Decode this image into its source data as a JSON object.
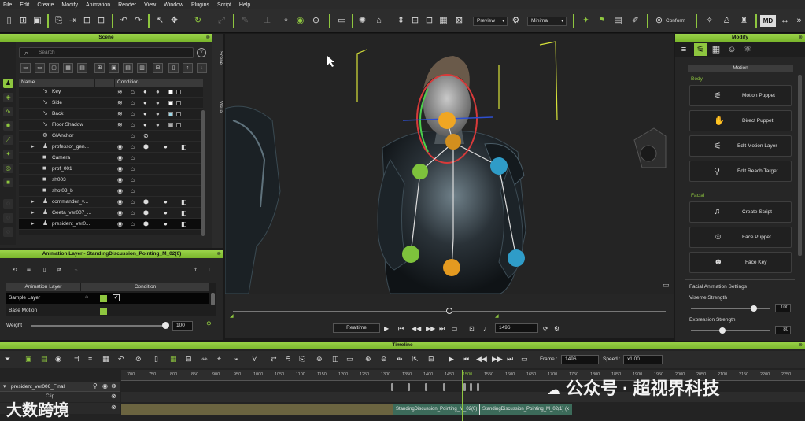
{
  "menu": [
    "File",
    "Edit",
    "Create",
    "Modify",
    "Animation",
    "Render",
    "View",
    "Window",
    "Plugins",
    "Script",
    "Help"
  ],
  "toolbar": {
    "preview_dropdown": "Preview",
    "quality_dropdown": "Minimal",
    "conform_label": "Conform",
    "accent_color": "#8ec63f"
  },
  "scene": {
    "title": "Scene",
    "search_placeholder": "Search",
    "col_name": "Name",
    "col_condition": "Condition",
    "tab_scene": "Scene",
    "tab_visual": "Visual",
    "rows": [
      {
        "name": "Key",
        "icon": "light-icon"
      },
      {
        "name": "Side",
        "icon": "light-icon"
      },
      {
        "name": "Back",
        "icon": "light-icon"
      },
      {
        "name": "Floor Shadow",
        "icon": "light-icon"
      },
      {
        "name": "GIAnchor",
        "icon": "anchor-icon"
      },
      {
        "name": "professor_gen...",
        "icon": "person-icon"
      },
      {
        "name": "Camera",
        "icon": "camera-icon"
      },
      {
        "name": "prof_001",
        "icon": "camera-icon"
      },
      {
        "name": "sh003",
        "icon": "camera-icon"
      },
      {
        "name": "shot03_b",
        "icon": "camera-icon"
      },
      {
        "name": "commander_v...",
        "icon": "person-icon"
      },
      {
        "name": "Geeta_ver007_...",
        "icon": "person-icon"
      },
      {
        "name": "president_ver0...",
        "icon": "person-icon"
      }
    ]
  },
  "anim_layer": {
    "title": "Animation Layer - StandingDiscussion_Pointing_M_02(0)",
    "col_layer": "Animation Layer",
    "col_condition": "Condition",
    "layers": [
      "Sample Layer",
      "Base Motion"
    ],
    "weight_label": "Weight",
    "weight_value": "100",
    "weight_fraction": 1.0
  },
  "playbar": {
    "realtime": "Realtime",
    "frame": "1496"
  },
  "modify": {
    "title": "Modify",
    "subheader": "Motion",
    "body_label": "Body",
    "body_buttons": [
      "Motion Puppet",
      "Direct Puppet",
      "Edit Motion Layer",
      "Edit Reach Target"
    ],
    "facial_label": "Facial",
    "facial_buttons": [
      "Create Script",
      "Face Puppet",
      "Face Key"
    ],
    "settings_label": "Facial Animation Settings",
    "viseme_label": "Viseme Strength",
    "viseme_value": "100",
    "viseme_fraction": 0.8,
    "expression_label": "Expression Strength",
    "expression_value": "80",
    "expression_fraction": 0.4
  },
  "timeline": {
    "title": "Timeline",
    "frame_label": "Frame :",
    "frame_value": "1496",
    "speed_label": "Speed :",
    "speed_value": "x1.00",
    "track_name": "president_ver006_Final",
    "sub_track_1": "Clip",
    "sub_track_2": "Motion",
    "ticks": [
      "700",
      "750",
      "800",
      "850",
      "900",
      "950",
      "1000",
      "1050",
      "1100",
      "1150",
      "1200",
      "1250",
      "1300",
      "1350",
      "1400",
      "1450",
      "1500",
      "1550",
      "1600",
      "1650",
      "1700",
      "1750",
      "1800",
      "1850",
      "1900",
      "1950",
      "2000",
      "2050",
      "2100",
      "2150",
      "2200",
      "2250"
    ],
    "clips": [
      "StandingDiscussion_Pointing_M_02(0)",
      "StandingDiscussion_Pointing_M_02(1) (x"
    ]
  },
  "watermark": {
    "right": "公众号 · 超视界科技",
    "left": "大数跨境"
  }
}
